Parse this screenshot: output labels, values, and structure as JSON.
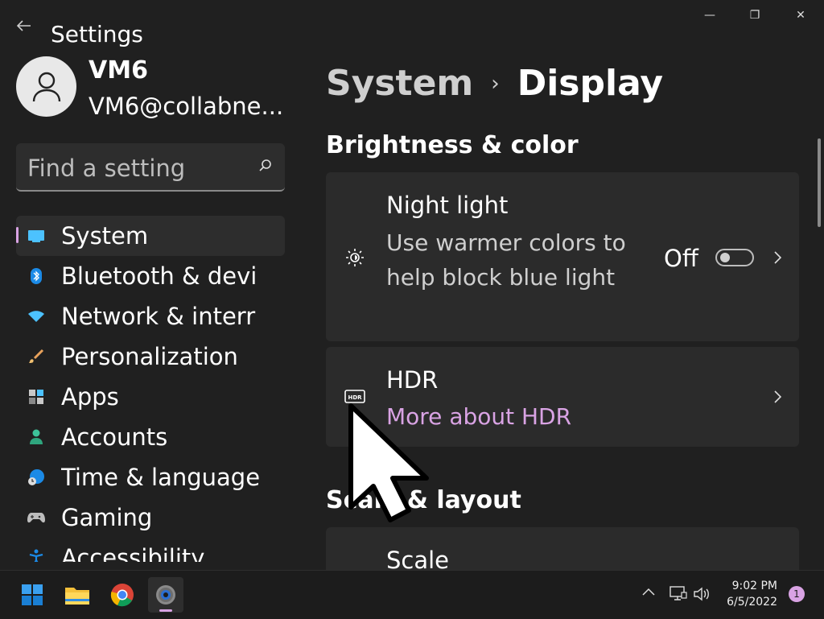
{
  "window": {
    "title": "Settings",
    "controls": {
      "minimize": "—",
      "restore": "❐",
      "close": "✕"
    }
  },
  "user": {
    "name": "VM6",
    "email": "VM6@collabne..."
  },
  "search": {
    "placeholder": "Find a setting"
  },
  "sidebar": {
    "items": [
      {
        "label": "System",
        "icon": "system-icon",
        "active": true
      },
      {
        "label": "Bluetooth & devi",
        "icon": "bluetooth-icon"
      },
      {
        "label": "Network & interr",
        "icon": "wifi-icon"
      },
      {
        "label": "Personalization",
        "icon": "brush-icon"
      },
      {
        "label": "Apps",
        "icon": "apps-icon"
      },
      {
        "label": "Accounts",
        "icon": "accounts-icon"
      },
      {
        "label": "Time & language",
        "icon": "globe-clock-icon"
      },
      {
        "label": "Gaming",
        "icon": "gamepad-icon"
      },
      {
        "label": "Accessibility",
        "icon": "accessibility-icon"
      }
    ]
  },
  "breadcrumb": {
    "parent": "System",
    "separator": "›",
    "current": "Display"
  },
  "sections": {
    "brightness": {
      "heading": "Brightness & color",
      "night_light": {
        "title": "Night light",
        "description": "Use warmer colors to help block blue light",
        "state_label": "Off",
        "state": false
      },
      "hdr": {
        "title": "HDR",
        "link": "More about HDR"
      }
    },
    "scale_layout": {
      "heading": "Scale & layout",
      "scale": {
        "title": "Scale"
      }
    }
  },
  "taskbar": {
    "apps": [
      "start-icon",
      "file-explorer-icon",
      "chrome-icon",
      "settings-icon"
    ],
    "clock": {
      "time": "9:02 PM",
      "date": "6/5/2022"
    },
    "notification_count": "1"
  },
  "colors": {
    "accent": "#d9a3e4",
    "background": "#202020",
    "card": "#2b2b2b"
  }
}
